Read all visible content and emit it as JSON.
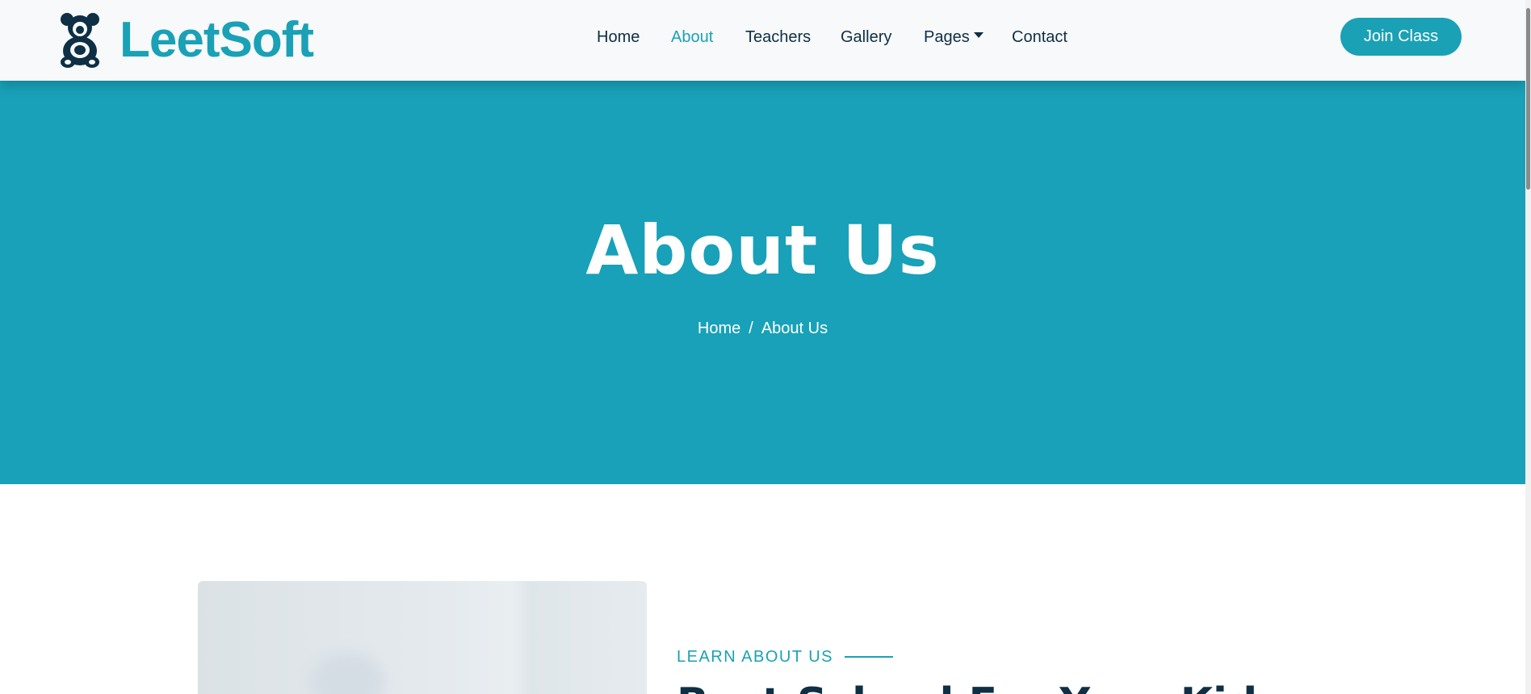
{
  "brand": {
    "name": "LeetSoft",
    "icon": "teddy-bear-icon"
  },
  "nav": {
    "items": [
      {
        "label": "Home",
        "active": false
      },
      {
        "label": "About",
        "active": true
      },
      {
        "label": "Teachers",
        "active": false
      },
      {
        "label": "Gallery",
        "active": false
      },
      {
        "label": "Pages",
        "active": false,
        "dropdown": true
      },
      {
        "label": "Contact",
        "active": false
      }
    ],
    "cta_label": "Join Class"
  },
  "hero": {
    "title": "About Us",
    "breadcrumb": {
      "home": "Home",
      "separator": "/",
      "current": "About Us"
    }
  },
  "about": {
    "eyebrow": "LEARN ABOUT US",
    "heading": "Best School For Your Kids"
  },
  "colors": {
    "accent": "#1aa1b6",
    "navy": "#0e2f44",
    "nav_bg": "#f7f9fb",
    "hero_bg": "#18a1b8"
  }
}
